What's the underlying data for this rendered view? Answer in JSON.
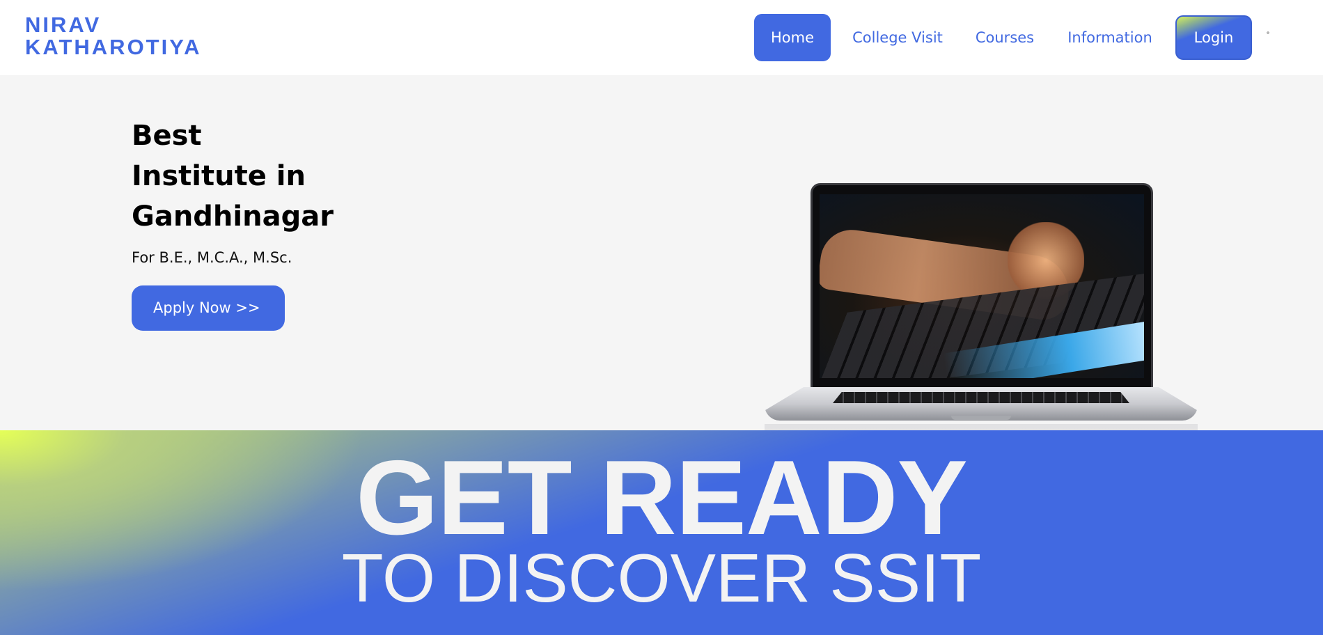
{
  "brand": {
    "line1": "NIRAV",
    "line2": "KATHAROTIYA",
    "color": "#4169e1"
  },
  "nav": {
    "items": [
      {
        "label": "Home",
        "active": true
      },
      {
        "label": "College Visit",
        "active": false
      },
      {
        "label": "Courses",
        "active": false
      },
      {
        "label": "Information",
        "active": false
      }
    ],
    "login_label": "Login",
    "toggle_glyph": "°"
  },
  "hero": {
    "title_lines": [
      "Best",
      "Institute in",
      "Gandhinagar"
    ],
    "subtitle": "For B.E., M.C.A., M.Sc.",
    "cta_label": "Apply Now >>",
    "image_icon": "laptop-typing-image"
  },
  "banner": {
    "line1": "GET READY",
    "line2": "TO DISCOVER SSIT"
  },
  "colors": {
    "accent": "#4169e1",
    "hero_bg": "#f5f5f5",
    "gradient_highlight": "#e5ff57",
    "banner_text": "#f3f3f3"
  }
}
